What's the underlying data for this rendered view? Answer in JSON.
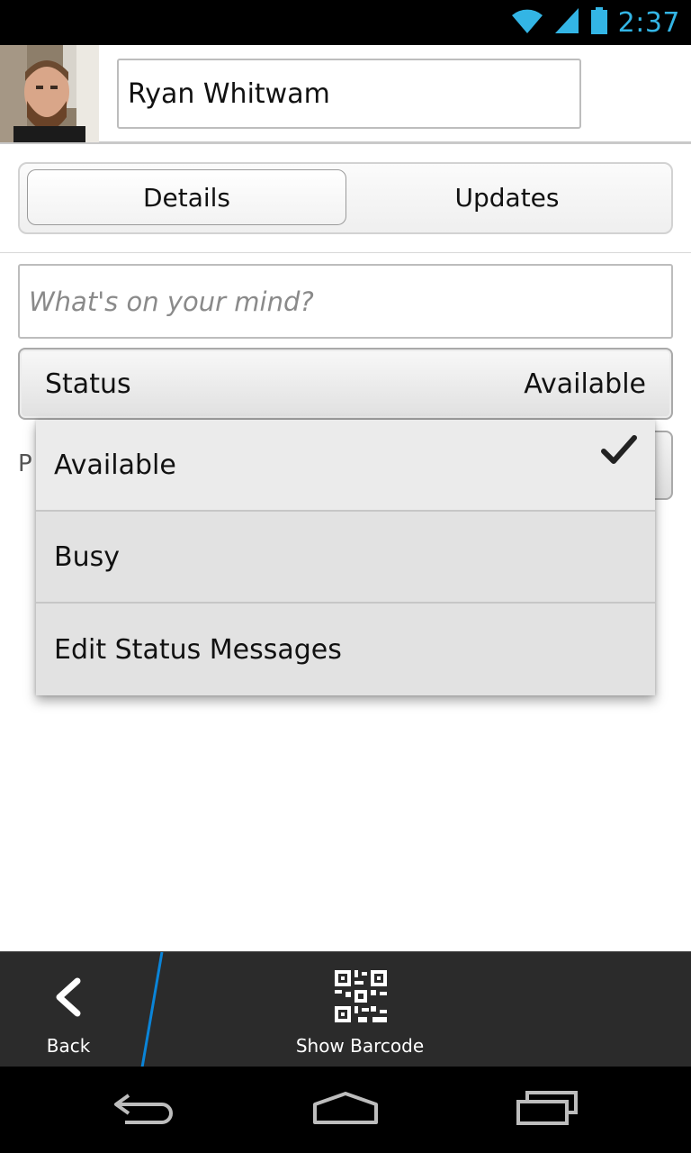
{
  "status_bar": {
    "time": "2:37",
    "icons": [
      "wifi-icon",
      "signal-icon",
      "battery-icon"
    ],
    "accent_color": "#33b5e5"
  },
  "profile": {
    "name_value": "Ryan Whitwam",
    "avatar": "profile-photo"
  },
  "tabs": [
    {
      "label": "Details",
      "selected": true
    },
    {
      "label": "Updates",
      "selected": false
    }
  ],
  "mind_input": {
    "placeholder": "What's on your mind?"
  },
  "status_select": {
    "label": "Status",
    "value": "Available"
  },
  "background_peek": {
    "label_fragment": "P"
  },
  "dropdown": {
    "items": [
      {
        "label": "Available",
        "checked": true
      },
      {
        "label": "Busy",
        "checked": false
      },
      {
        "label": "Edit Status Messages",
        "checked": false
      }
    ]
  },
  "action_bar": {
    "back_label": "Back",
    "barcode_label": "Show Barcode",
    "divider_color": "#0a84d8"
  },
  "nav_bar": {
    "buttons": [
      "back-nav-icon",
      "home-nav-icon",
      "recents-nav-icon"
    ]
  }
}
